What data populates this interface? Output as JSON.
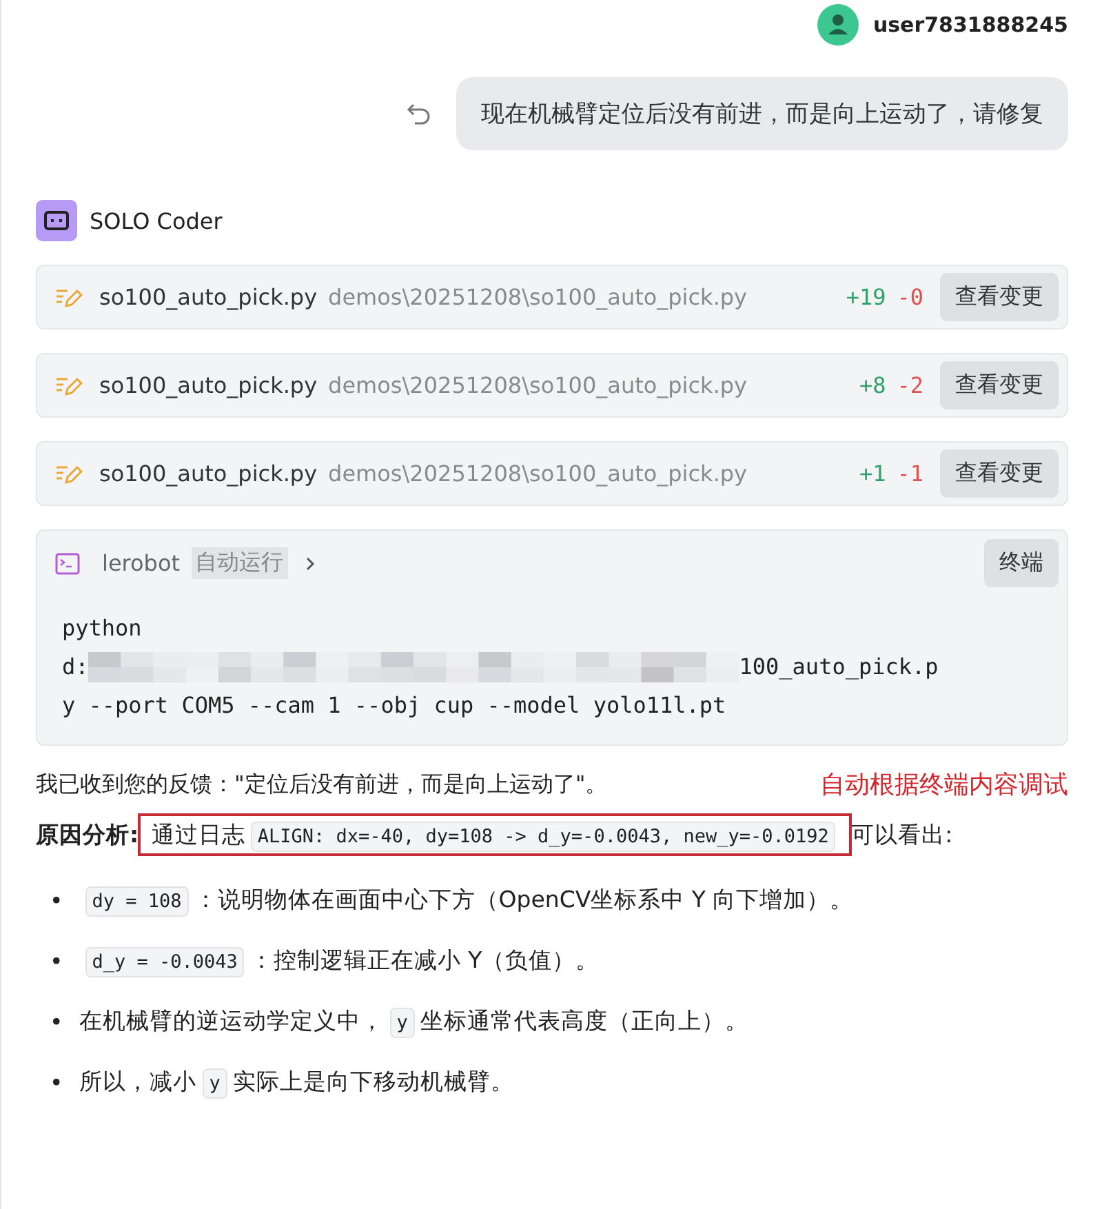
{
  "user": {
    "name": "user7831888245"
  },
  "user_message": {
    "text": "现在机械臂定位后没有前进，而是向上运动了，请修复"
  },
  "agent": {
    "name": "SOLO Coder"
  },
  "file_changes": [
    {
      "file": "so100_auto_pick.py",
      "path": "demos\\20251208\\so100_auto_pick.py",
      "additions": "+19",
      "deletions": "-0",
      "button": "查看变更"
    },
    {
      "file": "so100_auto_pick.py",
      "path": "demos\\20251208\\so100_auto_pick.py",
      "additions": "+8",
      "deletions": "-2",
      "button": "查看变更"
    },
    {
      "file": "so100_auto_pick.py",
      "path": "demos\\20251208\\so100_auto_pick.py",
      "additions": "+1",
      "deletions": "-1",
      "button": "查看变更"
    }
  ],
  "terminal": {
    "env": "lerobot",
    "mode": "自动运行",
    "button": "终端",
    "redacted": true,
    "line_1": "python",
    "line_2_start": "d:",
    "line_2_end": "100_auto_pick.p",
    "line_3": "y --port COM5 --cam 1 --obj cup --model yolo11l.pt"
  },
  "feedback": {
    "text": "我已收到您的反馈：\"定位后没有前进，而是向上运动了\"。",
    "annotation": "自动根据终端内容调试"
  },
  "cause": {
    "label": "原因分析:",
    "highlighted": [
      {
        "kind": "text",
        "text": "通过日志"
      },
      {
        "kind": "code",
        "text": "ALIGN: dx=-40, dy=108 -> d_y=-0.0043, new_y=-0.0192"
      }
    ],
    "rest": "可以看出:"
  },
  "bullets": [
    {
      "marker": "•",
      "segments": [
        {
          "kind": "code",
          "text": "dy = 108"
        },
        {
          "kind": "text",
          "text": "：说明物体在画面中心下方（OpenCV坐标系中 Y 向下增加）。"
        }
      ]
    },
    {
      "marker": "•",
      "segments": [
        {
          "kind": "code",
          "text": "d_y = -0.0043"
        },
        {
          "kind": "text",
          "text": "：控制逻辑正在减小 Y（负值）。"
        }
      ]
    },
    {
      "marker": "•",
      "segments": [
        {
          "kind": "text",
          "text": "在机械臂的逆运动学定义中，"
        },
        {
          "kind": "code",
          "text": "y"
        },
        {
          "kind": "text",
          "text": "坐标通常代表高度（正向上）。"
        }
      ]
    },
    {
      "marker": "•",
      "segments": [
        {
          "kind": "text",
          "text": "所以，减小"
        },
        {
          "kind": "code",
          "text": "y"
        },
        {
          "kind": "text",
          "text": "实际上是向下移动机械臂。"
        }
      ]
    }
  ]
}
